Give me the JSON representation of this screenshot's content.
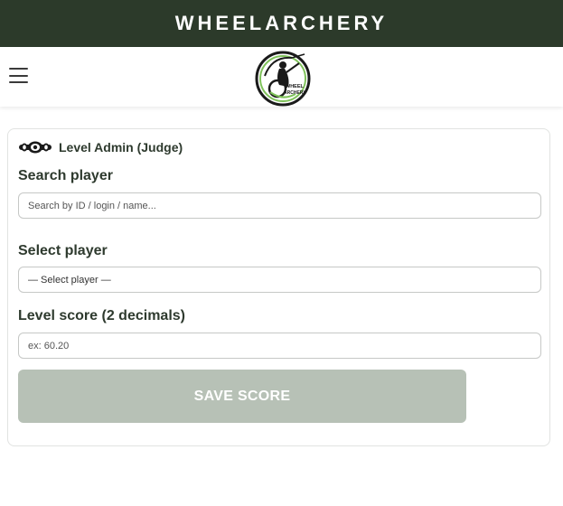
{
  "topbar": {
    "brand": "WHEELARCHERY"
  },
  "logo": {
    "line1": "WHEEL",
    "line2": "ARCHERY"
  },
  "panel": {
    "title": "Level Admin (Judge)",
    "search_label": "Search player",
    "search_placeholder": "Search by ID / login / name...",
    "select_label": "Select player",
    "select_value": "— Select player —",
    "score_label": "Level score (2 decimals)",
    "score_placeholder": "ex: 60.20",
    "save_label": "SAVE SCORE"
  },
  "colors": {
    "topbar_bg": "#2c3a2a",
    "text_dark": "#2e3a2e",
    "button_disabled": "#b7c1b6",
    "logo_accent": "#7fc25a"
  }
}
